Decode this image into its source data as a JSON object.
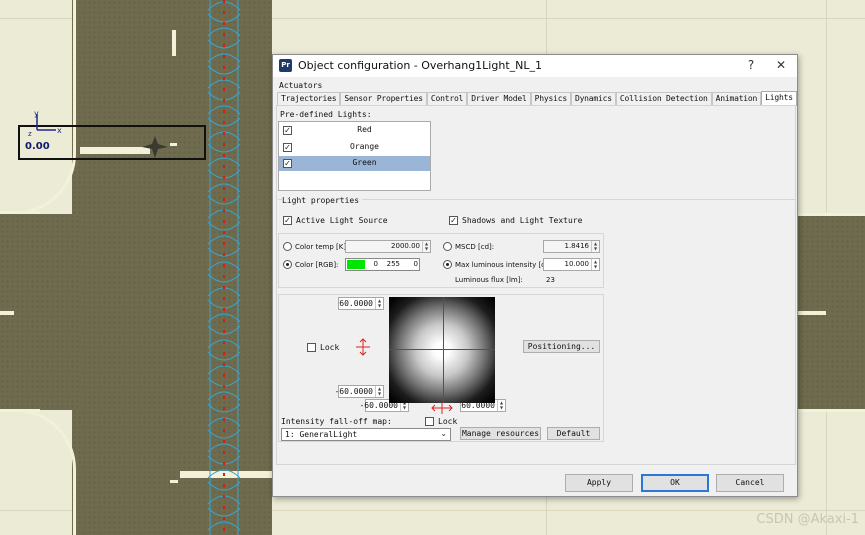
{
  "scene": {
    "coordinate_readout": "0.00",
    "axis_x": "x",
    "axis_y": "y",
    "axis_z": "z",
    "watermark": "CSDN @Akaxi-1"
  },
  "dialog": {
    "title": "Object configuration - Overhang1Light_NL_1",
    "app_icon": "Pr",
    "help_glyph": "?",
    "close_glyph": "✕",
    "actuators_label": "Actuators",
    "tabs": [
      {
        "label": "Trajectories",
        "active": false
      },
      {
        "label": "Sensor Properties",
        "active": false
      },
      {
        "label": "Control",
        "active": false
      },
      {
        "label": "Driver Model",
        "active": false
      },
      {
        "label": "Physics",
        "active": false
      },
      {
        "label": "Dynamics",
        "active": false
      },
      {
        "label": "Collision Detection",
        "active": false
      },
      {
        "label": "Animation",
        "active": false
      },
      {
        "label": "Lights",
        "active": true
      }
    ],
    "predefined_label": "Pre-defined Lights:",
    "lights": [
      {
        "name": "Red",
        "checked": true,
        "selected": false
      },
      {
        "name": "Orange",
        "checked": true,
        "selected": false
      },
      {
        "name": "Green",
        "checked": true,
        "selected": true
      }
    ],
    "light_properties_label": "Light properties",
    "active_light_source": {
      "label": "Active Light Source",
      "checked": true
    },
    "shadows_texture": {
      "label": "Shadows and Light Texture",
      "checked": true
    },
    "color_temp": {
      "label": "Color temp [K]:",
      "value": "2000.00",
      "selected": false
    },
    "color_rgb": {
      "label": "Color [RGB]:",
      "r": "0",
      "g": "255",
      "b": "0",
      "swatch": "#00e600",
      "selected": true
    },
    "mscd": {
      "label": "MSCD [cd]:",
      "value": "1.8416",
      "selected": false
    },
    "max_intensity": {
      "label": "Max luminous intensity [cd]:",
      "value": "10.000",
      "selected": true
    },
    "luminous_flux": {
      "label": "Luminous flux [lm]:",
      "value": "23"
    },
    "falloff": {
      "top_value": "60.0000",
      "bottom_value": "-60.0000",
      "left_value": "-60.0000",
      "right_value": "60.0000",
      "lock_vertical": {
        "label": "Lock",
        "checked": false
      },
      "lock_horizontal": {
        "label": "Lock",
        "checked": false
      },
      "positioning_label": "Positioning...",
      "map_label": "Intensity fall-off map:",
      "map_value": "1: GeneralLight",
      "manage_label": "Manage resources",
      "default_label": "Default"
    },
    "footer": {
      "apply": "Apply",
      "ok": "OK",
      "cancel": "Cancel"
    }
  }
}
